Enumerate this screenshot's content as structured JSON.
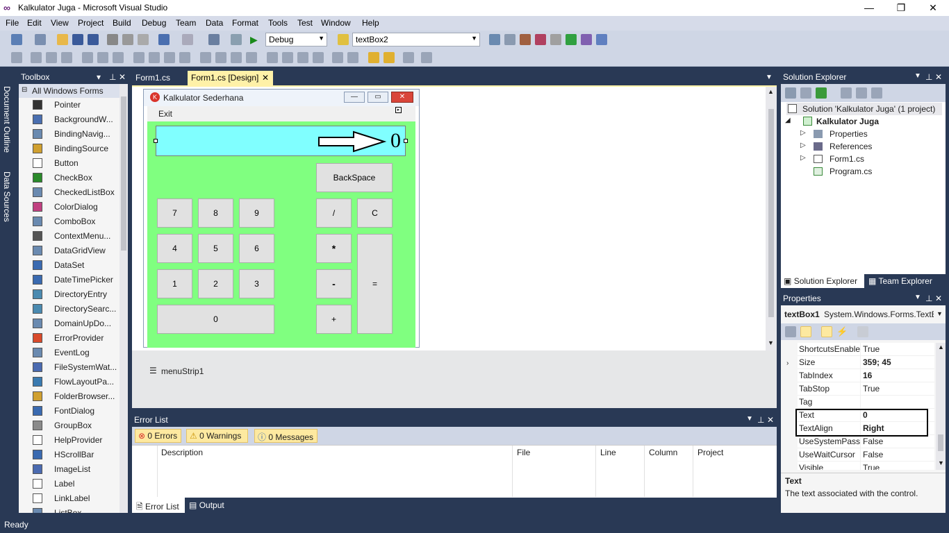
{
  "window": {
    "title": "Kalkulator Juga - Microsoft Visual Studio"
  },
  "menu": [
    "File",
    "Edit",
    "View",
    "Project",
    "Build",
    "Debug",
    "Team",
    "Data",
    "Format",
    "Tools",
    "Test",
    "Window",
    "Help"
  ],
  "toolbar": {
    "config": "Debug",
    "object_combo": "textBox2"
  },
  "side_tabs": [
    "Document Outline",
    "Data Sources"
  ],
  "toolbox": {
    "title": "Toolbox",
    "group": "All Windows Forms",
    "items": [
      "Pointer",
      "BackgroundW...",
      "BindingNavig...",
      "BindingSource",
      "Button",
      "CheckBox",
      "CheckedListBox",
      "ColorDialog",
      "ComboBox",
      "ContextMenu...",
      "DataGridView",
      "DataSet",
      "DateTimePicker",
      "DirectoryEntry",
      "DirectorySearc...",
      "DomainUpDo...",
      "ErrorProvider",
      "EventLog",
      "FileSystemWat...",
      "FlowLayoutPa...",
      "FolderBrowser...",
      "FontDialog",
      "GroupBox",
      "HelpProvider",
      "HScrollBar",
      "ImageList",
      "Label",
      "LinkLabel",
      "ListBox"
    ]
  },
  "doc_tabs": [
    "Form1.cs",
    "Form1.cs [Design]"
  ],
  "form": {
    "title": "Kalkulator Sederhana",
    "menu_exit": "Exit",
    "display_value": "0",
    "buttons": {
      "backspace": "BackSpace",
      "b7": "7",
      "b8": "8",
      "b9": "9",
      "b4": "4",
      "b5": "5",
      "b6": "6",
      "b1": "1",
      "b2": "2",
      "b3": "3",
      "b0": "0",
      "div": "/",
      "clear": "C",
      "mul": "*",
      "sub": "-",
      "add": "+",
      "eq": "="
    }
  },
  "tray": {
    "menustrip": "menuStrip1"
  },
  "error_list": {
    "title": "Error List",
    "errors": "0 Errors",
    "warnings": "0 Warnings",
    "messages": "0 Messages",
    "columns": [
      "Description",
      "File",
      "Line",
      "Column",
      "Project"
    ],
    "bottom_tabs": [
      "Error List",
      "Output"
    ]
  },
  "solution_explorer": {
    "title": "Solution Explorer",
    "solution": "Solution 'Kalkulator Juga' (1 project)",
    "project": "Kalkulator Juga",
    "items": [
      "Properties",
      "References",
      "Form1.cs",
      "Program.cs"
    ],
    "bottom_tabs": [
      "Solution Explorer",
      "Team Explorer"
    ]
  },
  "properties": {
    "title": "Properties",
    "object_name": "textBox1",
    "object_type": "System.Windows.Forms.TextB",
    "rows": [
      {
        "name": "ShortcutsEnabled",
        "value": "True"
      },
      {
        "name": "Size",
        "value": "359; 45"
      },
      {
        "name": "TabIndex",
        "value": "16"
      },
      {
        "name": "TabStop",
        "value": "True"
      },
      {
        "name": "Tag",
        "value": ""
      },
      {
        "name": "Text",
        "value": "0"
      },
      {
        "name": "TextAlign",
        "value": "Right"
      },
      {
        "name": "UseSystemPasswordChar",
        "value": "False"
      },
      {
        "name": "UseWaitCursor",
        "value": "False"
      },
      {
        "name": "Visible",
        "value": "True"
      }
    ],
    "desc_title": "Text",
    "desc_body": "The text associated with the control."
  },
  "status": {
    "text": "Ready"
  }
}
